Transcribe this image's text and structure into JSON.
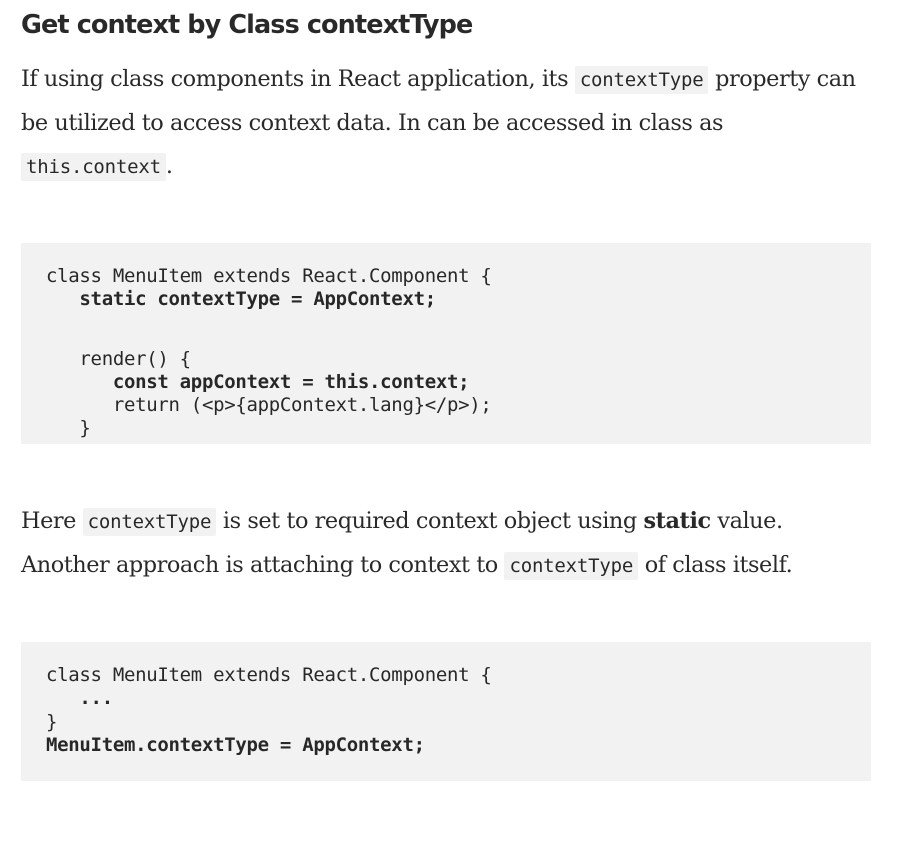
{
  "heading": "Get context by Class contextType",
  "paragraph1": {
    "text_a": "If using class components in React application, its ",
    "code_a": "contextType",
    "text_b": " property can be utilized to access context data. In can be accessed in class as ",
    "code_b": "this.context",
    "text_c": "."
  },
  "code_block_1": {
    "lines": [
      "class MenuItem extends React.Component {",
      "   static contextType = AppContext;",
      "",
      "   render() {",
      "      const appContext = this.context;",
      "      return (<p>{appContext.lang}</p>);",
      "   }",
      "}"
    ]
  },
  "paragraph2": {
    "text_a": "Here ",
    "code_a": "contextType",
    "text_b": " is set to required context object using ",
    "bold": "static",
    "text_c": " value. Another approach is attaching to context to ",
    "code_b": "contextType",
    "text_d": " of class itself."
  },
  "code_block_2": {
    "lines": [
      "class MenuItem extends React.Component {",
      "   ...",
      "}",
      "MenuItem.contextType = AppContext;"
    ]
  }
}
